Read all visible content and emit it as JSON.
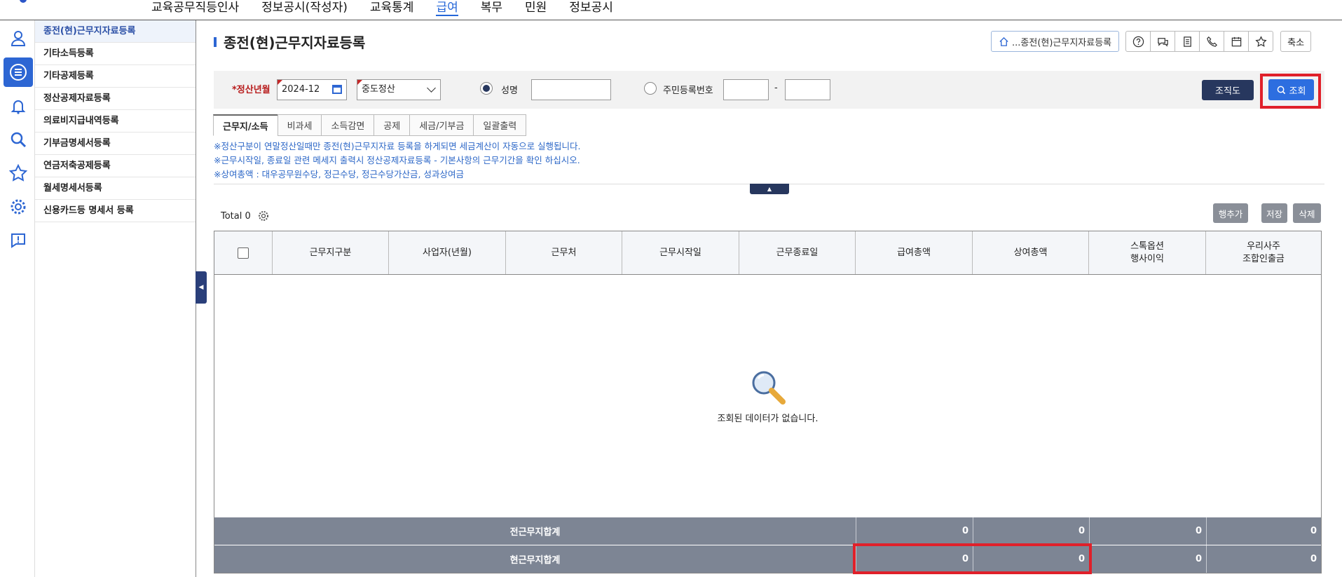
{
  "top_menu": {
    "items": [
      "교육공무직등인사",
      "정보공시(작성자)",
      "교육통계",
      "급여",
      "복무",
      "민원",
      "정보공시"
    ],
    "active_index": 3
  },
  "rail_icons": [
    "person-icon",
    "list-icon",
    "bell-icon",
    "search-icon",
    "star-icon",
    "gear-icon",
    "alert-icon"
  ],
  "submenu": {
    "items": [
      "종전(현)근무지자료등록",
      "기타소득등록",
      "기타공제등록",
      "정산공제자료등록",
      "의료비지급내역등록",
      "기부금명세서등록",
      "연금저축공제등록",
      "월세명세서등록",
      "신용카드등 명세서 등록"
    ],
    "active_index": 0
  },
  "page": {
    "title": "종전(현)근무지자료등록",
    "breadcrumb": "...종전(현)근무지자료등록",
    "shrink_label": "축소"
  },
  "search": {
    "year_label": "*정산년월",
    "year_value": "2024-12",
    "type_value": "중도정산",
    "radio_name_label": "성명",
    "radio_rrn_label": "주민등록번호",
    "name_value": "",
    "rrn_part1": "",
    "rrn_part2": "",
    "dash": "-",
    "org_label": "조직도",
    "query_label": "조회"
  },
  "tabs": {
    "items": [
      "근무지/소득",
      "비과세",
      "소득감면",
      "공제",
      "세금/기부금",
      "일괄출력"
    ],
    "active_index": 0
  },
  "notes": [
    "※정산구분이 연말정산일때만 종전(현)근무지자료 등록을 하게되면 세금계산이 자동으로 실행됩니다.",
    "※근무시작일, 종료일 관련 메세지 출력시 정산공제자료등록 - 기본사항의 근무기간을 확인 하십시오.",
    "※상여총액 : 대우공무원수당, 정근수당, 정근수당가산금, 성과상여금"
  ],
  "grid": {
    "total_label": "Total 0",
    "buttons": {
      "add_row": "행추가",
      "save": "저장",
      "delete": "삭제"
    },
    "columns": [
      "근무지구분",
      "사업자(년월)",
      "근무처",
      "근무시작일",
      "근무종료일",
      "급여총액",
      "상여총액",
      "스톡옵션\n행사이익",
      "우리사주\n조합인출금"
    ],
    "empty_message": "조회된 데이터가 없습니다.",
    "footer_rows": [
      {
        "label": "전근무지합계",
        "values": [
          "0",
          "0",
          "0",
          "0"
        ]
      },
      {
        "label": "현근무지합계",
        "values": [
          "0",
          "0",
          "0",
          "0"
        ]
      }
    ]
  },
  "colors": {
    "accent": "#2d66d3",
    "navy": "#27375e",
    "highlight": "#e0202a",
    "footer": "#7d8594"
  }
}
